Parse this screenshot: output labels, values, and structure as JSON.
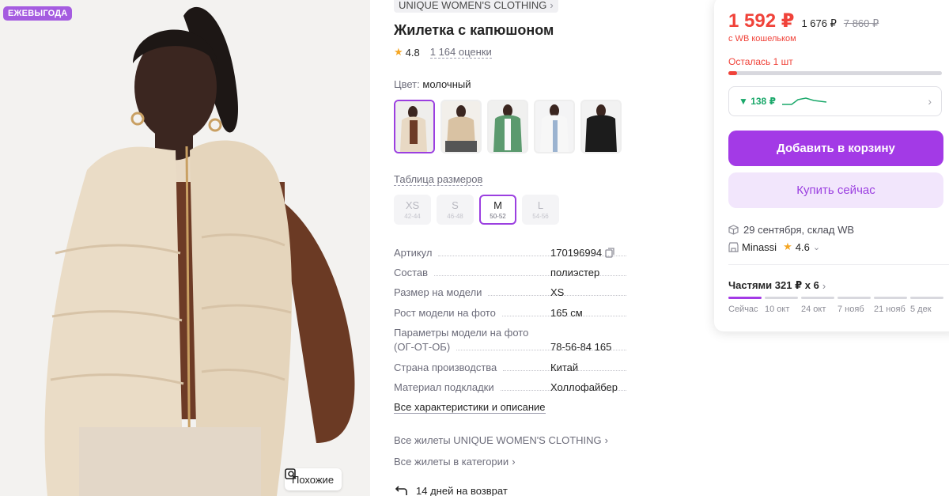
{
  "badge": "ЕЖЕВЫГОДА",
  "similar_label": "Похожие",
  "brand": "UNIQUE WOMEN'S CLOTHING",
  "title": "Жилетка с капюшоном",
  "rating": "4.8",
  "reviews": "1 164 оценки",
  "color": {
    "label": "Цвет:",
    "value": "молочный"
  },
  "size_table": "Таблица размеров",
  "sizes": [
    {
      "size": "XS",
      "range": "42-44"
    },
    {
      "size": "S",
      "range": "46-48"
    },
    {
      "size": "M",
      "range": "50-52"
    },
    {
      "size": "L",
      "range": "54-56"
    }
  ],
  "specs": [
    {
      "key": "Артикул",
      "value": "170196994"
    },
    {
      "key": "Состав",
      "value": "полиэстер"
    },
    {
      "key": "Размер на модели",
      "value": "XS"
    },
    {
      "key": "Рост модели на фото",
      "value": "165 см"
    },
    {
      "key": "Параметры модели на фото",
      "key2": "(ОГ-ОТ-ОБ)",
      "value": "78-56-84 165"
    },
    {
      "key": "Страна производства",
      "value": "Китай"
    },
    {
      "key": "Материал подкладки",
      "value": "Холлофайбер"
    }
  ],
  "all_specs": "Все характеристики и описание",
  "links": [
    "Все жилеты UNIQUE WOMEN'S CLOTHING",
    "Все жилеты в категории"
  ],
  "return_text": "14 дней на возврат",
  "card": {
    "price": "1 592 ₽",
    "price_2": "1 676 ₽",
    "price_old": "7 860 ₽",
    "wallet": "с WB кошельком",
    "stock": "Осталась 1 шт",
    "trend": "▼ 138 ₽",
    "add_to_cart": "Добавить в корзину",
    "buy_now": "Купить сейчас",
    "delivery": "29 сентября, склад WB",
    "seller": "Minassi",
    "seller_rating": "4.6",
    "parts": "Частями 321 ₽ х 6",
    "part_dates": [
      "Сейчас",
      "10 окт",
      "24 окт",
      "7 нояб",
      "21 нояб",
      "5 дек"
    ]
  },
  "colors": {
    "accent": "#a33ae6",
    "price": "#f0433a",
    "green": "#1aa86a"
  }
}
